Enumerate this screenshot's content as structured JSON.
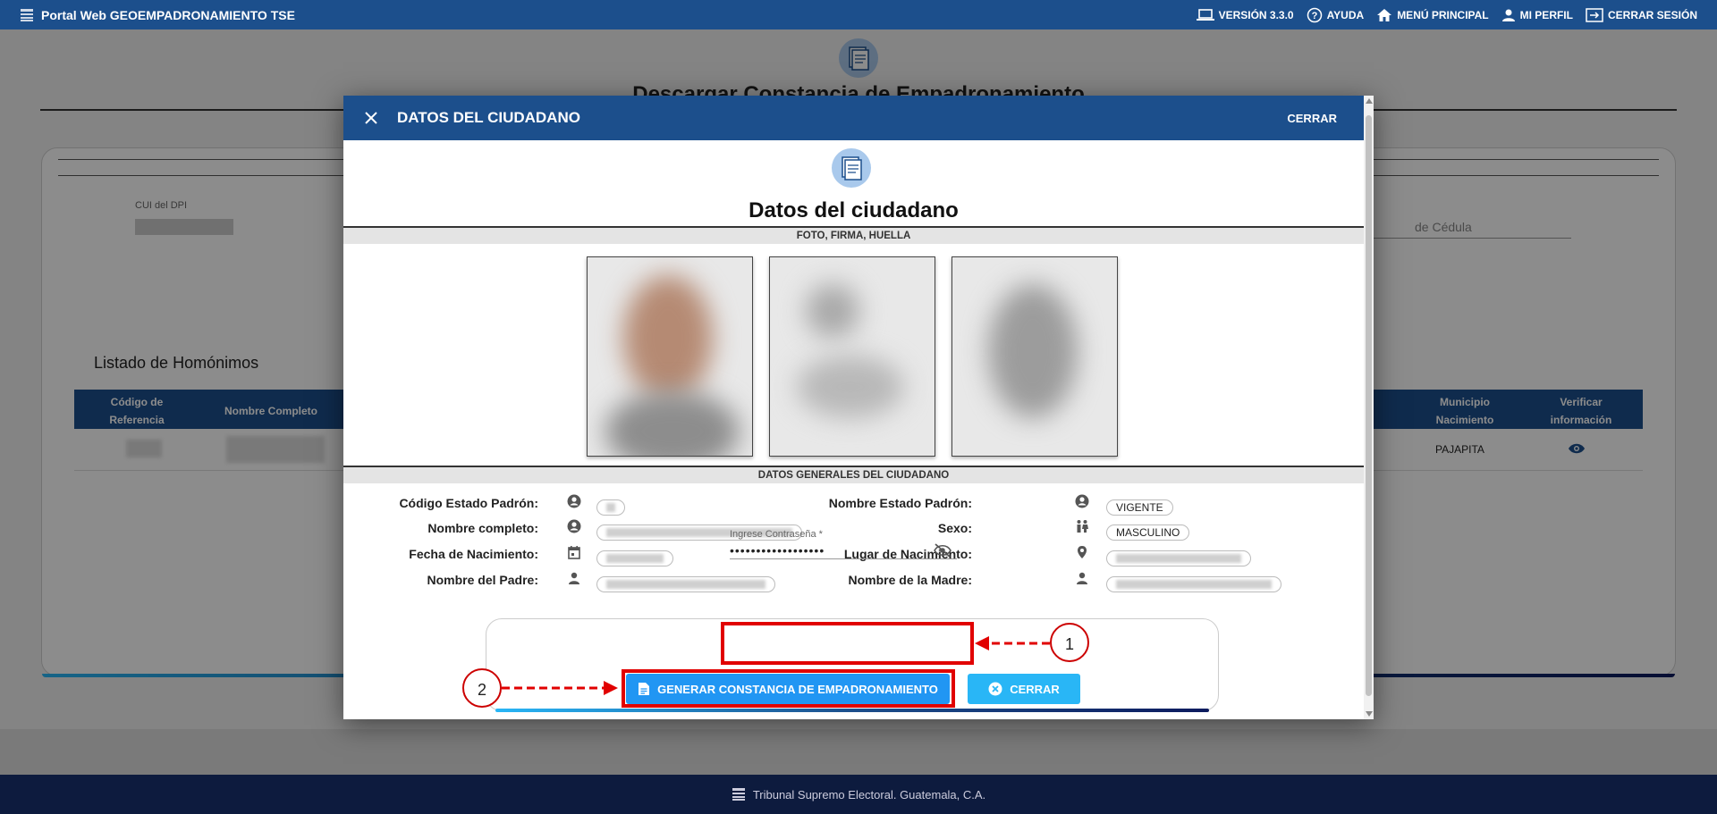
{
  "topbar": {
    "app_title": "Portal Web GEOEMPADRONAMIENTO TSE",
    "version": "VERSIÓN 3.3.0",
    "help": "AYUDA",
    "main_menu": "MENÚ PRINCIPAL",
    "profile": "MI PERFIL",
    "logout": "CERRAR SESIÓN"
  },
  "page": {
    "title": "Descargar Constancia de Empadronamiento",
    "dpi_label": "CUI del DPI",
    "cedula_placeholder": "de Cédula",
    "homonimos_title": "Listado de Homónimos",
    "table": {
      "headers": [
        "Código de Referencia",
        "Nombre Completo",
        "Municipio Nacimiento",
        "Verificar información"
      ],
      "rows": [
        {
          "municipio": "PAJAPITA"
        }
      ]
    }
  },
  "footer": {
    "text": "Tribunal Supremo Electoral. Guatemala, C.A."
  },
  "modal": {
    "header_title": "DATOS DEL CIUDADANO",
    "header_close": "CERRAR",
    "title": "Datos del ciudadano",
    "section_media": "FOTO, FIRMA, HUELLA",
    "section_general": "DATOS GENERALES DEL CIUDADANO",
    "fields_left": [
      {
        "label": "Código Estado Padrón:",
        "icon": "account-circle-icon",
        "value": ""
      },
      {
        "label": "Nombre completo:",
        "icon": "account-circle-icon",
        "value": ""
      },
      {
        "label": "Fecha de Nacimiento:",
        "icon": "calendar-icon",
        "value": ""
      },
      {
        "label": "Nombre del Padre:",
        "icon": "person-icon",
        "value": ""
      }
    ],
    "fields_right": [
      {
        "label": "Nombre Estado Padrón:",
        "icon": "account-circle-icon",
        "value": "VIGENTE"
      },
      {
        "label": "Sexo:",
        "icon": "gender-icon",
        "value": "MASCULINO"
      },
      {
        "label": "Lugar de Nacimiento:",
        "icon": "location-pin-icon",
        "value": ""
      },
      {
        "label": "Nombre de la Madre:",
        "icon": "person-icon",
        "value": ""
      }
    ],
    "password": {
      "label": "Ingrese Contraseña *",
      "value": "••••••••••••••••••"
    },
    "generate_button": "GENERAR CONSTANCIA DE EMPADRONAMIENTO",
    "close_button": "CERRAR"
  },
  "annotations": {
    "callout_1": "1",
    "callout_2": "2",
    "highlight_color": "#e10000"
  },
  "colors": {
    "primary": "#1c4f8c",
    "button_blue": "#2196f3",
    "button_light": "#29b6f6"
  }
}
